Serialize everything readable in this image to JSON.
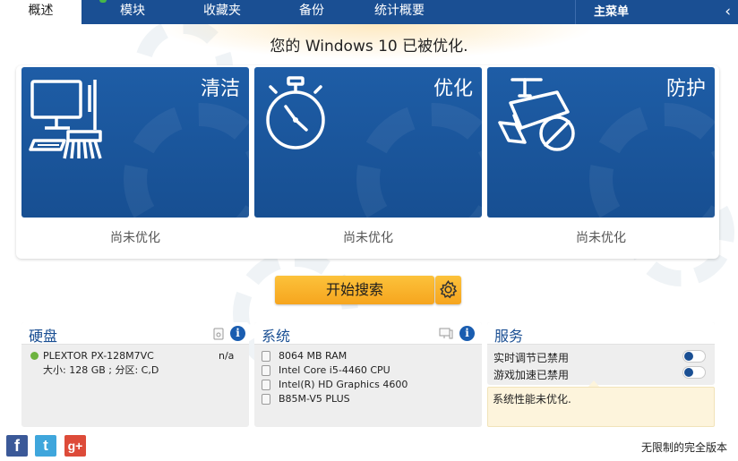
{
  "nav": {
    "tabs": [
      "概述",
      "模块",
      "收藏夹",
      "备份",
      "统计概要"
    ],
    "main_menu": "主菜单",
    "collapse_icon": "chevron-left-icon"
  },
  "status_title": "您的 Windows 10 已被优化.",
  "panels": [
    {
      "title": "清洁",
      "status": "尚未优化",
      "icon": "computer-broom-icon"
    },
    {
      "title": "优化",
      "status": "尚未优化",
      "icon": "stopwatch-icon"
    },
    {
      "title": "防护",
      "status": "尚未优化",
      "icon": "camera-block-icon"
    }
  ],
  "start_button": "开始搜索",
  "disk": {
    "title": "硬盘",
    "name": "PLEXTOR PX-128M7VC",
    "value": "n/a",
    "detail": "大小: 128 GB ; 分区: C,D"
  },
  "system": {
    "title": "系统",
    "items": [
      "8064 MB RAM",
      "Intel Core i5-4460 CPU",
      "Intel(R) HD Graphics 4600",
      "B85M-V5 PLUS"
    ]
  },
  "services": {
    "title": "服务",
    "rows": [
      "实时调节已禁用",
      "游戏加速已禁用"
    ],
    "note": "系统性能未优化."
  },
  "social": {
    "facebook": "f",
    "twitter": "t",
    "google": "g+"
  },
  "footer": "无限制的完全版本",
  "colors": {
    "nav_bg": "#1a4f93",
    "panel_bg": "#1e5da6",
    "accent_orange": "#f6a51e",
    "status_green": "#6db33f"
  }
}
